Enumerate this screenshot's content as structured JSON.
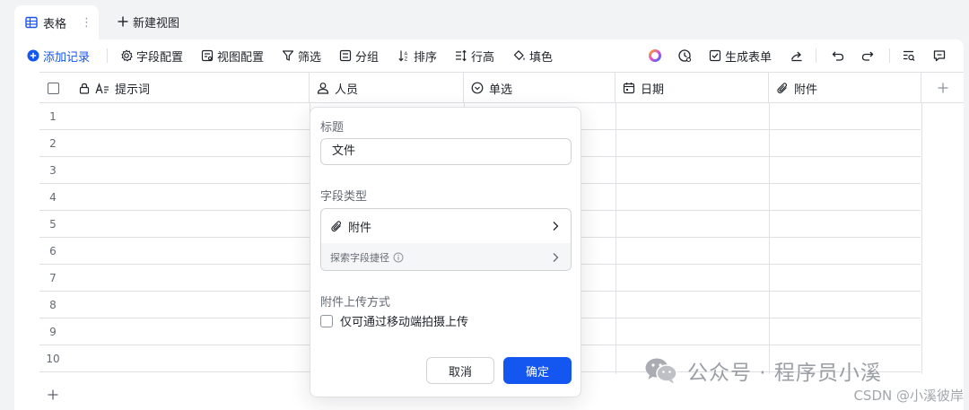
{
  "view_tabs": {
    "active_tab": "表格",
    "more": "⋮",
    "new_view": "新建视图"
  },
  "toolbar": {
    "add_record": "添加记录",
    "field_config": "字段配置",
    "view_config": "视图配置",
    "filter": "筛选",
    "group": "分组",
    "sort": "排序",
    "row_height": "行高",
    "fill_color": "填色",
    "generate_form": "生成表单"
  },
  "grid": {
    "columns": [
      {
        "label": "提示词",
        "icon": "text-field-icon",
        "locked": true
      },
      {
        "label": "人员",
        "icon": "person-field-icon"
      },
      {
        "label": "单选",
        "icon": "single-select-icon"
      },
      {
        "label": "日期",
        "icon": "date-field-icon"
      },
      {
        "label": "附件",
        "icon": "attachment-field-icon"
      }
    ],
    "row_numbers": [
      "1",
      "2",
      "3",
      "4",
      "5",
      "6",
      "7",
      "8",
      "9",
      "10"
    ]
  },
  "popover": {
    "title_label": "标题",
    "title_value": "文件",
    "field_type_label": "字段类型",
    "field_type_value": "附件",
    "explore_shortcut": "探索字段捷径",
    "upload_method_label": "附件上传方式",
    "mobile_only_option": "仅可通过移动端拍摄上传",
    "mobile_only_checked": false,
    "cancel": "取消",
    "confirm": "确定"
  },
  "watermark": {
    "text": "公众号 · 程序员小溪",
    "credit": "CSDN @小溪彼岸"
  },
  "colors": {
    "accent": "#1456f0",
    "border": "#dee0e3",
    "background": "#f2f3f5"
  }
}
